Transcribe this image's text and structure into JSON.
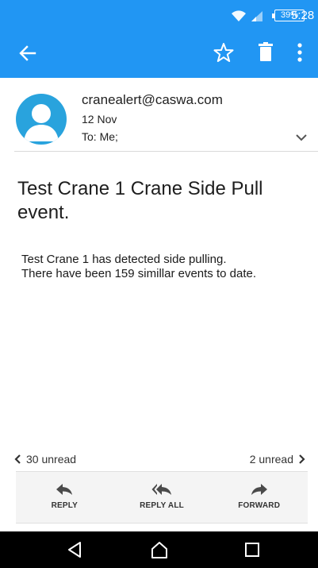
{
  "status_bar": {
    "battery": "39%",
    "time": "5:28",
    "icons": [
      "wifi-icon",
      "signal-icon",
      "battery-icon"
    ]
  },
  "app_bar": {
    "background": "#2196f3",
    "icons": [
      "back-arrow-icon",
      "star-icon",
      "trash-icon",
      "more-vert-icon"
    ]
  },
  "message": {
    "sender": "cranealert@caswa.com",
    "date": "12 Nov",
    "to": "To: Me;",
    "subject": "Test Crane 1 Crane Side Pull event.",
    "body_lines": [
      "Test Crane 1 has detected side pulling.",
      "There have been 159 simillar events to date."
    ]
  },
  "navigation": {
    "prev_unread": "30 unread",
    "next_unread": "2 unread"
  },
  "actions": [
    {
      "label": "REPLY",
      "icon": "reply-icon"
    },
    {
      "label": "REPLY ALL",
      "icon": "reply-all-icon"
    },
    {
      "label": "FORWARD",
      "icon": "forward-icon"
    }
  ],
  "system_nav": {
    "icons": [
      "nav-back-icon",
      "nav-home-icon",
      "nav-recents-icon"
    ]
  }
}
